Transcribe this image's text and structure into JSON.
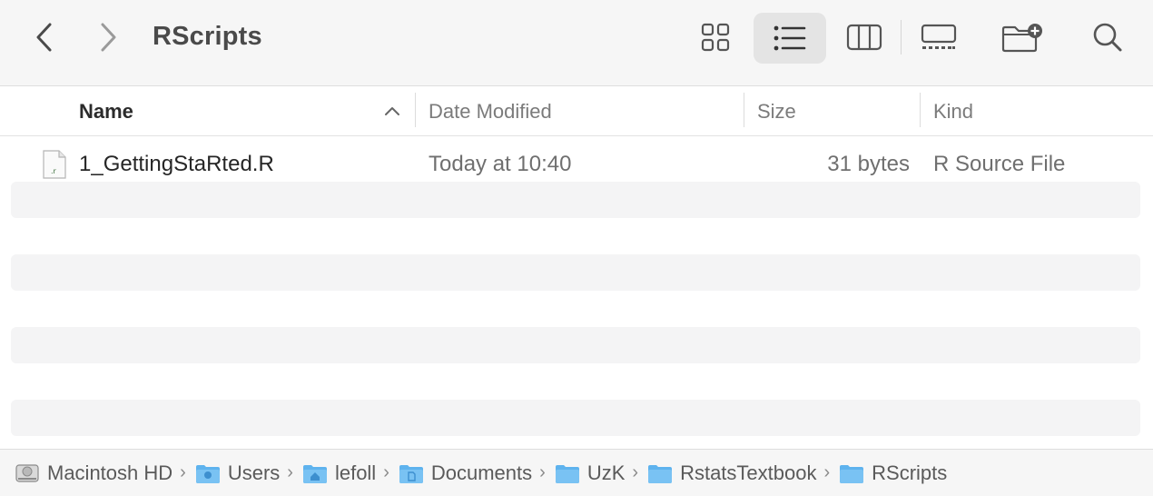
{
  "window": {
    "title": "RScripts"
  },
  "toolbar": {
    "back_icon": "chevron-left-icon",
    "forward_icon": "chevron-right-icon",
    "view_icons_icon": "grid-icon",
    "view_list_icon": "list-icon",
    "view_columns_icon": "columns-icon",
    "view_gallery_icon": "gallery-icon",
    "new_folder_icon": "folder-plus-icon",
    "search_icon": "search-icon"
  },
  "columns": {
    "name": "Name",
    "date": "Date Modified",
    "size": "Size",
    "kind": "Kind",
    "sort": "name-ascending"
  },
  "files": [
    {
      "name": "1_GettingStaRted.R",
      "icon_label": ".r",
      "date": "Today at 10:40",
      "size": "31 bytes",
      "kind": "R Source File"
    }
  ],
  "pathbar": {
    "items": [
      {
        "label": "Macintosh HD",
        "icon": "hard-drive-icon"
      },
      {
        "label": "Users",
        "icon": "users-folder-icon"
      },
      {
        "label": "lefoll",
        "icon": "home-folder-icon"
      },
      {
        "label": "Documents",
        "icon": "documents-folder-icon"
      },
      {
        "label": "UzK",
        "icon": "folder-icon"
      },
      {
        "label": "RstatsTextbook",
        "icon": "folder-icon"
      },
      {
        "label": "RScripts",
        "icon": "folder-icon"
      }
    ],
    "separator": "›"
  },
  "colors": {
    "folder": "#5eb3ee",
    "stripe": "#f4f4f5",
    "toolbar_bg": "#f6f6f6",
    "selected_view_bg": "#e4e4e4"
  }
}
